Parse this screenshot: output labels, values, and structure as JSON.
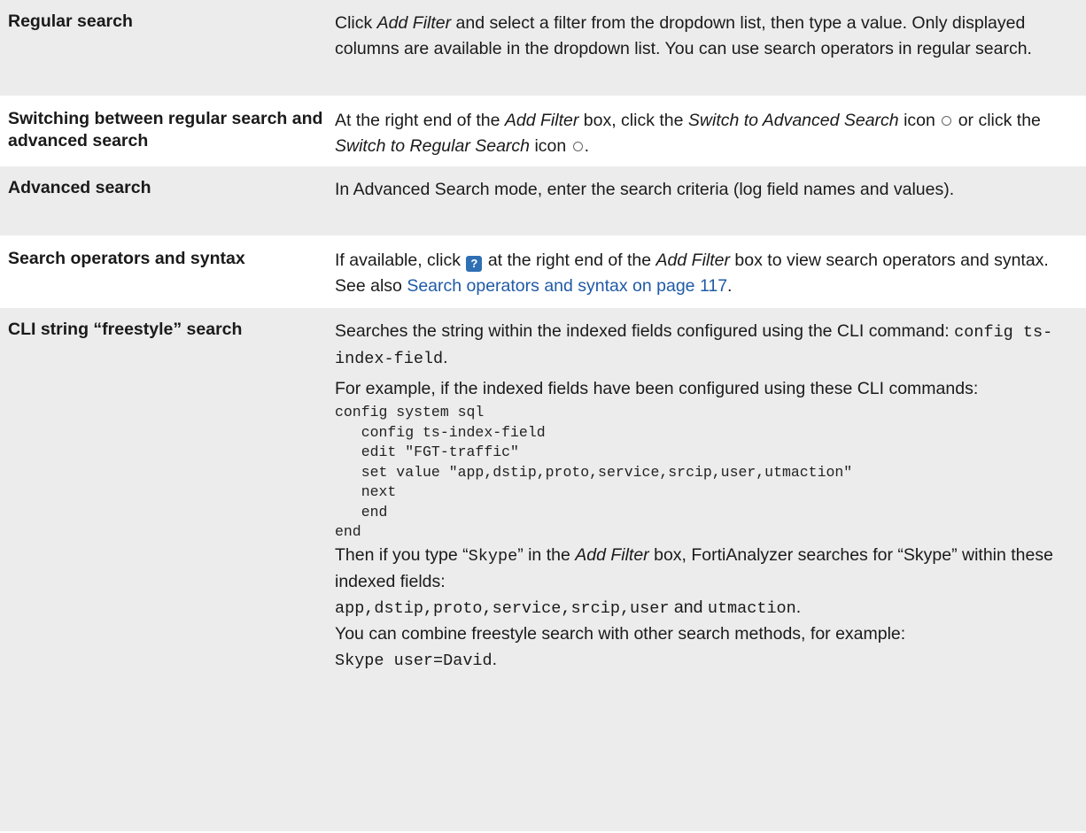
{
  "rows": [
    {
      "label": "Regular search",
      "p1": "Click ",
      "p1_em": "Add Filter",
      "p1_rest": " and select a filter from the dropdown list, then type a value. Only displayed columns are available in the dropdown list. You can use search operators in regular search."
    },
    {
      "label": "Switching between regular search and advanced search",
      "t1": "At the right end of the ",
      "em1": "Add Filter",
      "t2": " box, click the ",
      "em2": "Switch to Advanced Search",
      "t3": " icon",
      "t4": " or click the ",
      "em3": "Switch to Regular Search",
      "t5": " icon",
      "t6": "."
    },
    {
      "label": "Advanced search",
      "text": "In Advanced Search mode, enter the search criteria (log field names and values)."
    },
    {
      "label": "Search operators and syntax",
      "t1": "If available, click ",
      "help_glyph": "?",
      "t2": " at the right end of the ",
      "em1": "Add Filter",
      "t3": " box to view search operators and syntax. See also ",
      "link": "Search operators and syntax on page 117",
      "t4": "."
    },
    {
      "label": "CLI string “freestyle” search",
      "p1": "Searches the string within the indexed fields configured using the CLI command: ",
      "p1_code": "config ts-index-field",
      "p1_end": ".",
      "p2": "For example, if the indexed fields have been configured using these CLI commands:",
      "code": "config system sql\n   config ts-index-field\n   edit \"FGT-traffic\"\n   set value \"app,dstip,proto,service,srcip,user,utmaction\"\n   next\n   end\nend",
      "p3a": "Then if you type “",
      "p3_code": "Skype",
      "p3b": "” in the ",
      "p3_em": "Add Filter",
      "p3c": " box, FortiAnalyzer searches for “Skype” within these indexed fields:",
      "p4_code1": "app,dstip,proto,service,srcip,user",
      "p4_and": " and ",
      "p4_code2": "utmaction",
      "p4_end": ".",
      "p5": "You can combine freestyle search with other search methods, for example:",
      "p5_code": "Skype user=David",
      "p5_end": "."
    }
  ]
}
